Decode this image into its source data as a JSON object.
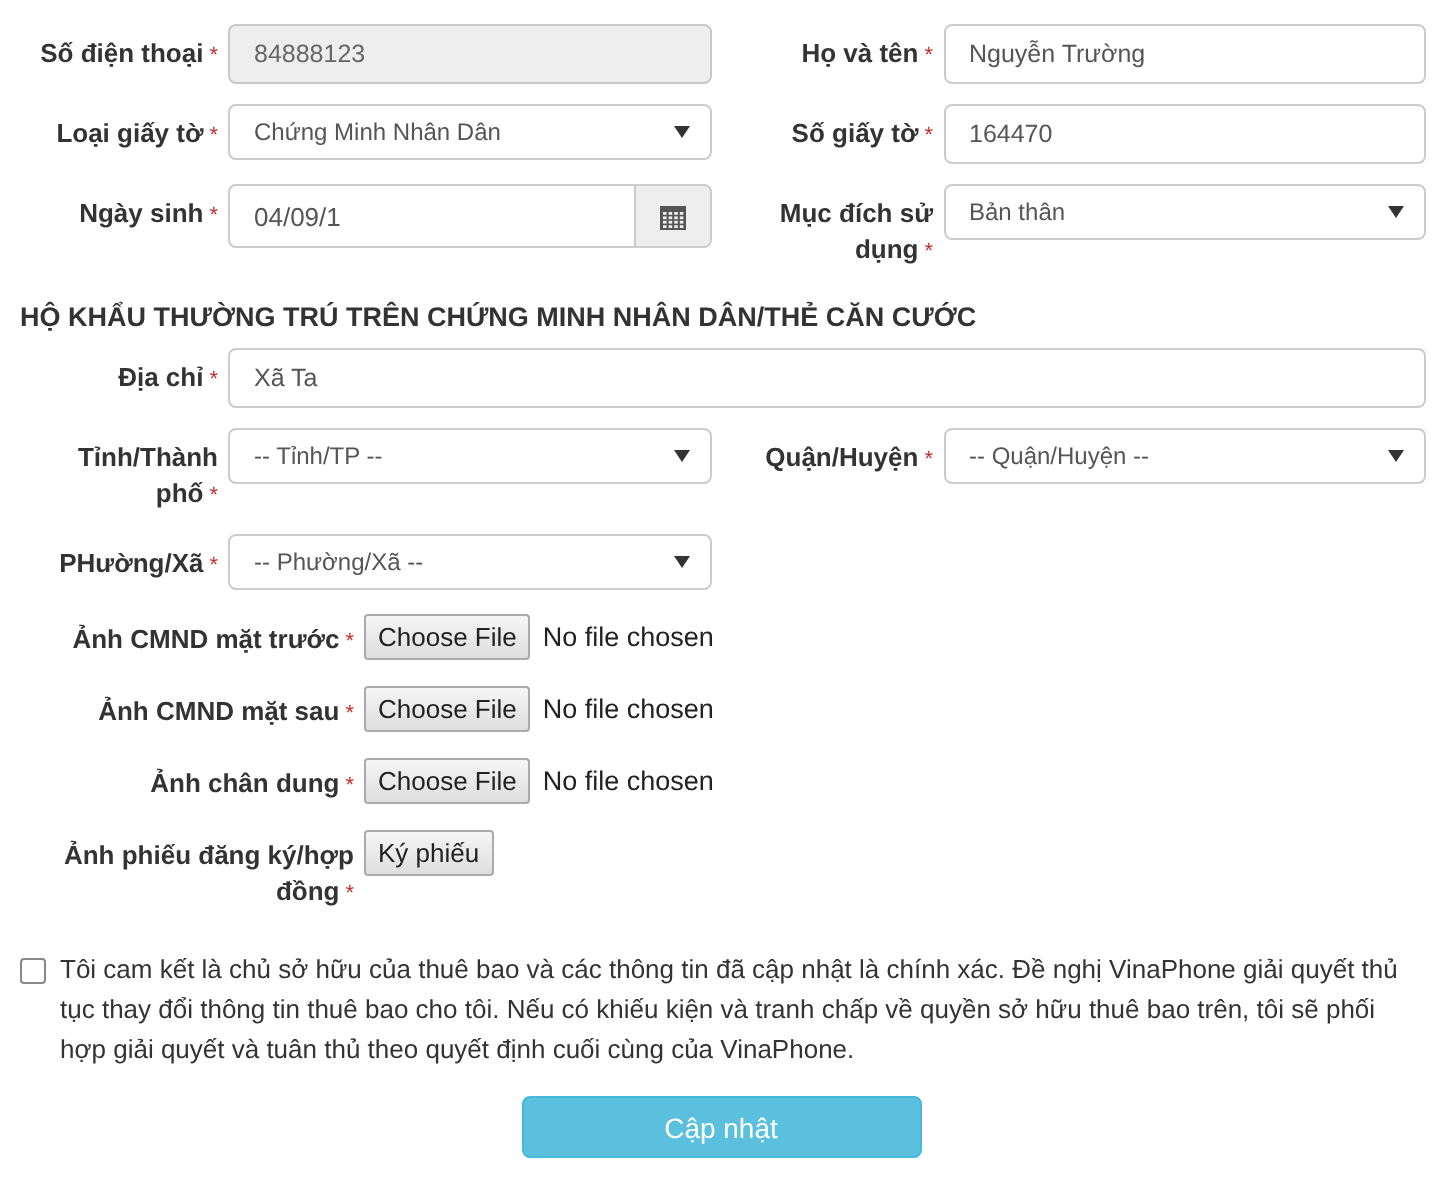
{
  "personal_rows": [
    [
      {
        "label": "Số điện thoại",
        "mark": "*",
        "kind": "input",
        "value": "84888123",
        "disabled": true
      },
      {
        "label": "Họ và tên",
        "mark": "*",
        "kind": "input",
        "value": "Nguyễn Trường",
        "disabled": false
      }
    ],
    [
      {
        "label": "Loại giấy tờ",
        "mark": "*",
        "kind": "select",
        "value": "Chứng Minh Nhân Dân"
      },
      {
        "label": "Số giấy tờ",
        "mark": "*",
        "kind": "input",
        "value": "164470",
        "disabled": false
      }
    ],
    [
      {
        "label": "Ngày sinh",
        "mark": "*",
        "kind": "date",
        "value": "04/09/1"
      },
      {
        "label": "Mục đích sử dụng",
        "mark": "*",
        "kind": "select",
        "value": "Bản thân"
      }
    ]
  ],
  "section_title": "HỘ KHẨU THƯỜNG TRÚ TRÊN CHỨNG MINH NHÂN DÂN/THẺ CĂN CƯỚC",
  "address": {
    "label": "Địa chỉ",
    "mark": "*",
    "value": "Xã Ta"
  },
  "address_rows": [
    [
      {
        "label": "Tỉnh/Thành phố",
        "mark": "*",
        "kind": "select",
        "value": "-- Tỉnh/TP --"
      },
      {
        "label": "Quận/Huyện",
        "mark": "*",
        "kind": "select",
        "value": "-- Quận/Huyện --"
      }
    ],
    [
      {
        "label": "PHường/Xã",
        "mark": "*",
        "kind": "select",
        "value": "-- Phường/Xã --"
      }
    ]
  ],
  "uploads": [
    {
      "label": "Ảnh CMND mặt trước",
      "mark": "*",
      "kind": "file",
      "button": "Choose File",
      "status": "No file chosen"
    },
    {
      "label": "Ảnh CMND mặt sau",
      "mark": "*",
      "kind": "file",
      "button": "Choose File",
      "status": "No file chosen"
    },
    {
      "label": "Ảnh chân dung",
      "mark": "*",
      "kind": "file",
      "button": "Choose File",
      "status": "No file chosen"
    },
    {
      "label": "Ảnh phiếu đăng ký/hợp đồng",
      "mark": "*",
      "kind": "button",
      "button": "Ký phiếu"
    }
  ],
  "consent": {
    "checked": false,
    "text": "Tôi cam kết là chủ sở hữu của thuê bao và các thông tin đã cập nhật là chính xác. Đề nghị VinaPhone giải quyết thủ tục thay đổi thông tin thuê bao cho tôi. Nếu có khiếu kiện và tranh chấp về quyền sở hữu thuê bao trên, tôi sẽ phối hợp giải quyết và tuân thủ theo quyết định cuối cùng của VinaPhone."
  },
  "submit": "Cập nhật"
}
